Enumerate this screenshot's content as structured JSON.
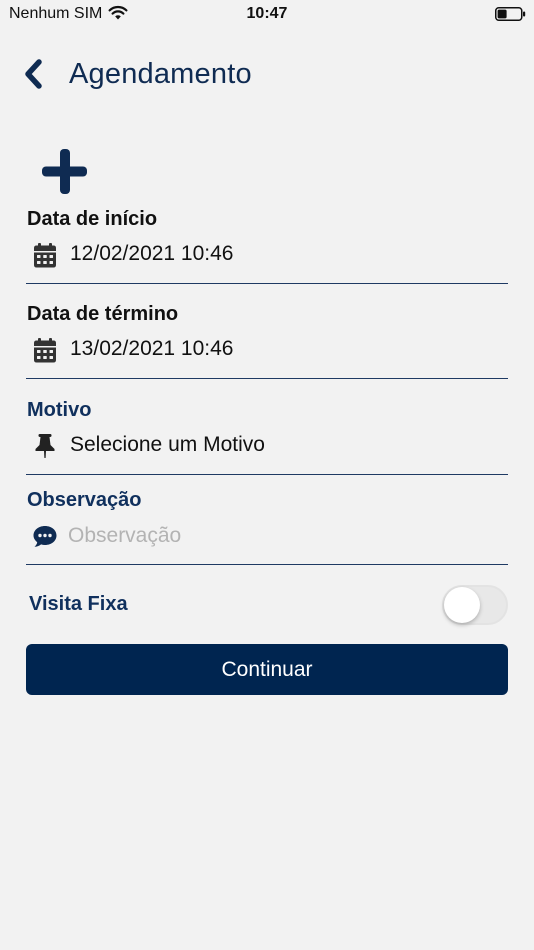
{
  "status_bar": {
    "carrier": "Nenhum SIM",
    "time": "10:47"
  },
  "header": {
    "title": "Agendamento",
    "back_icon": "chevron-left-icon"
  },
  "actions": {
    "add_icon": "plus-icon"
  },
  "form": {
    "start_date": {
      "label": "Data de início",
      "value": "12/02/2021 10:46",
      "icon": "calendar-icon"
    },
    "end_date": {
      "label": "Data de término",
      "value": "13/02/2021 10:46",
      "icon": "calendar-icon"
    },
    "reason": {
      "label": "Motivo",
      "value": "Selecione um Motivo",
      "icon": "pin-icon"
    },
    "observation": {
      "label": "Observação",
      "placeholder": "Observação",
      "value": "",
      "icon": "chat-icon"
    },
    "fixed_visit": {
      "label": "Visita Fixa",
      "enabled": false
    }
  },
  "continue_button": {
    "label": "Continuar"
  },
  "colors": {
    "primary": "#002550",
    "title": "#0f2b52",
    "background": "#f2f2f2",
    "placeholder": "#b3b3b3"
  }
}
